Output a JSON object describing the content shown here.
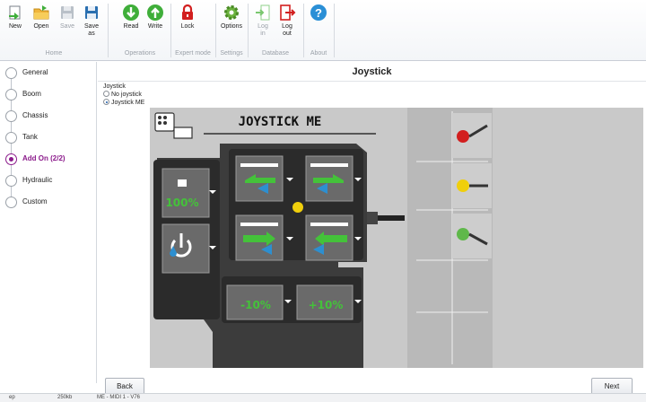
{
  "ribbon": {
    "buttons": [
      {
        "label": "New",
        "icon": "new-icon"
      },
      {
        "label": "Open",
        "icon": "open-folder-icon"
      },
      {
        "label": "Save",
        "icon": "save-icon",
        "disabled": true
      },
      {
        "label": "Save as",
        "icon": "save-as-icon"
      },
      {
        "label": "Read",
        "icon": "read-download-icon"
      },
      {
        "label": "Write",
        "icon": "write-upload-icon"
      },
      {
        "label": "Lock",
        "icon": "lock-icon"
      },
      {
        "label": "Options",
        "icon": "gear-icon"
      },
      {
        "label": "Log in",
        "icon": "login-icon",
        "disabled": true
      },
      {
        "label": "Log out",
        "icon": "logout-icon"
      },
      {
        "label": "",
        "icon": "help-icon"
      }
    ],
    "groups": [
      "Home",
      "Operations",
      "Expert mode",
      "Settings",
      "Database",
      "About"
    ]
  },
  "sidebar": {
    "steps": [
      {
        "label": "General",
        "active": false
      },
      {
        "label": "Boom",
        "active": false
      },
      {
        "label": "Chassis",
        "active": false
      },
      {
        "label": "Tank",
        "active": false
      },
      {
        "label": "Add On (2/2)",
        "active": true
      },
      {
        "label": "Hydraulic",
        "active": false
      },
      {
        "label": "Custom",
        "active": false
      }
    ]
  },
  "main": {
    "title": "Joystick",
    "joystick_group": {
      "label": "Joystick",
      "options": [
        {
          "label": "No joystick",
          "selected": false
        },
        {
          "label": "Joystick ME",
          "selected": true
        }
      ]
    },
    "diagram": {
      "heading": "JOYSTICK ME",
      "keys": [
        {
          "id": "k1",
          "text": "100%",
          "icon": "percent-100-icon"
        },
        {
          "id": "k2",
          "text": "",
          "icon": "power-icon"
        },
        {
          "id": "k3",
          "text": "",
          "icon": "section-left-icon"
        },
        {
          "id": "k4",
          "text": "",
          "icon": "section-right-icon"
        },
        {
          "id": "k5",
          "text": "",
          "icon": "section-in-right-icon"
        },
        {
          "id": "k6",
          "text": "",
          "icon": "section-in-left-icon"
        },
        {
          "id": "k7",
          "text": "-10%",
          "icon": "minus-10-percent-icon"
        },
        {
          "id": "k8",
          "text": "+10%",
          "icon": "plus-10-percent-icon"
        }
      ],
      "levers": [
        {
          "color": "#d21f1f"
        },
        {
          "color": "#f0cf0c"
        },
        {
          "color": "#5fb84a"
        }
      ]
    },
    "back_label": "Back",
    "next_label": "Next"
  },
  "status": {
    "cells": [
      "ep",
      "250kb",
      "ME - MIDI 1 - V76"
    ]
  },
  "colors": {
    "accent": "#8b1a8b",
    "joystick_body": "#3a3a3a",
    "key_green": "#3fae3a",
    "key_blue": "#2d8fd0"
  }
}
